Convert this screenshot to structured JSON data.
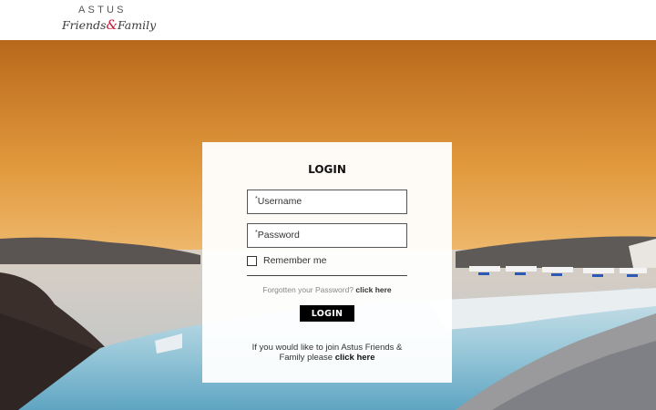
{
  "header": {
    "logo_top": "ASTUS",
    "logo_part1": "Friends",
    "logo_amp": "&",
    "logo_part2": "Family"
  },
  "login": {
    "title": "LOGIN",
    "username_required_mark": "*",
    "username_placeholder": "Username",
    "password_required_mark": "*",
    "password_placeholder": "Password",
    "remember_label": "Remember me",
    "remember_checked": false,
    "forgot_text": "Forgotten your Password?",
    "forgot_link": "click here",
    "submit_label": "LOGIN",
    "join_text_line1": "If you would like to join Astus Friends &",
    "join_text_line2": "Family please",
    "join_link": "click here"
  },
  "colors": {
    "accent": "#c8102e",
    "button_bg": "#000000",
    "sky_top": "#c9751a",
    "sky_horizon": "#f6cf8e",
    "pool": "#8fc3d6"
  }
}
